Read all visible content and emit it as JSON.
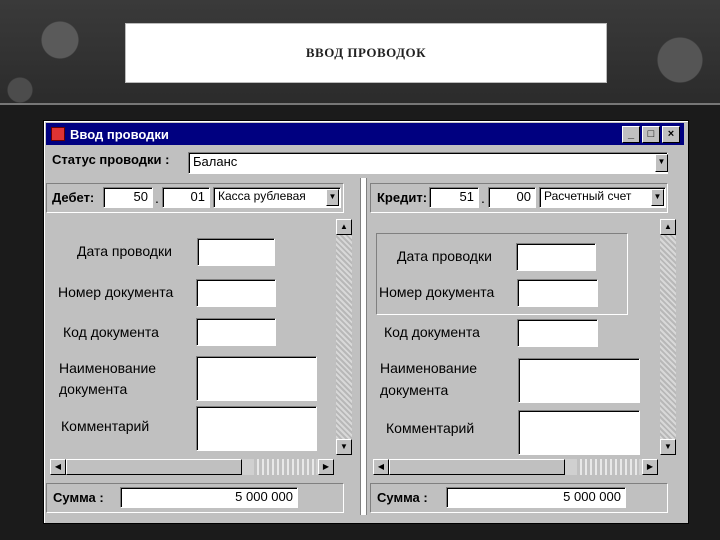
{
  "slide": {
    "title": "ВВОД ПРОВОДОК"
  },
  "window": {
    "title": "Ввод проводки",
    "buttons": {
      "minimize": "_",
      "maximize": "□",
      "close": "×"
    }
  },
  "status": {
    "label": "Статус проводки :",
    "value": "Баланс"
  },
  "debit": {
    "label": "Дебет:",
    "account": "50",
    "sub": "01",
    "account_name": "Касса рублевая",
    "fields": {
      "date": "Дата проводки",
      "doc_number": "Номер документа",
      "doc_code": "Код документа",
      "doc_name_1": "Наименование",
      "doc_name_2": "документа",
      "comment": "Комментарий"
    },
    "sum_label": "Сумма :",
    "sum_value": "5 000 000"
  },
  "credit": {
    "label": "Кредит:",
    "account": "51",
    "sub": "00",
    "account_name": "Расчетный счет",
    "fields": {
      "date": "Дата проводки",
      "doc_number": "Номер документа",
      "doc_code": "Код документа",
      "doc_name_1": "Наименование",
      "doc_name_2": "документа",
      "comment": "Комментарий"
    },
    "sum_label": "Сумма :",
    "sum_value": "5 000 000"
  },
  "glyphs": {
    "dot": ".",
    "arrow_down": "▼",
    "arrow_up": "▲",
    "arrow_left": "◀",
    "arrow_right": "▶"
  }
}
